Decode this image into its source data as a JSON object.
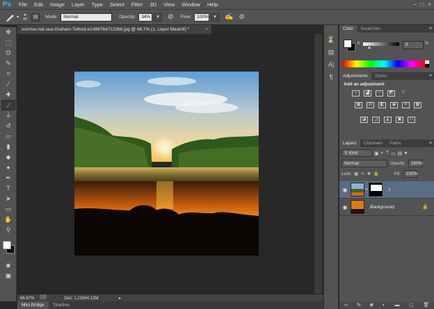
{
  "app": {
    "logo": "Ps"
  },
  "menubar": {
    "items": [
      "File",
      "Edit",
      "Image",
      "Layer",
      "Type",
      "Select",
      "Filter",
      "3D",
      "View",
      "Window",
      "Help"
    ],
    "window_controls": [
      "−",
      "□",
      "×"
    ]
  },
  "options": {
    "brush_size": "40",
    "mode_label": "Mode:",
    "mode_value": "Normal",
    "opacity_label": "Opacity:",
    "opacity_value": "34%",
    "flow_label": "Flow:",
    "flow_value": "100%"
  },
  "document": {
    "tab_title": "sunrise-red-sea-Graham-Telford-e1489764712368.jpg @ 66.7% (1, Layer Mask/8) *",
    "tab_close": "×",
    "zoom": "66.67%",
    "doc_info": "Doc: 1.21M/4.12M"
  },
  "bottom_tabs": [
    "Mini Bridge",
    "Timeline"
  ],
  "color_panel": {
    "tabs": [
      "Color",
      "Swatches"
    ],
    "channel_value": "0",
    "channel_unit": "%"
  },
  "adjustments_panel": {
    "tabs": [
      "Adjustments",
      "Styles"
    ],
    "heading": "Add an adjustment"
  },
  "layers_panel": {
    "tabs": [
      "Layers",
      "Channels",
      "Paths"
    ],
    "filter_kind": "Kind",
    "blend_mode": "Normal",
    "opacity_label": "Opacity:",
    "opacity_value": "100%",
    "lock_label": "Lock:",
    "fill_label": "Fill:",
    "fill_value": "100%",
    "layers": [
      {
        "name": "1",
        "selected": true
      },
      {
        "name": "Background",
        "selected": false
      }
    ]
  },
  "colors": {
    "accent": "#3fb0f0",
    "selected_layer": "#5a6d85"
  }
}
